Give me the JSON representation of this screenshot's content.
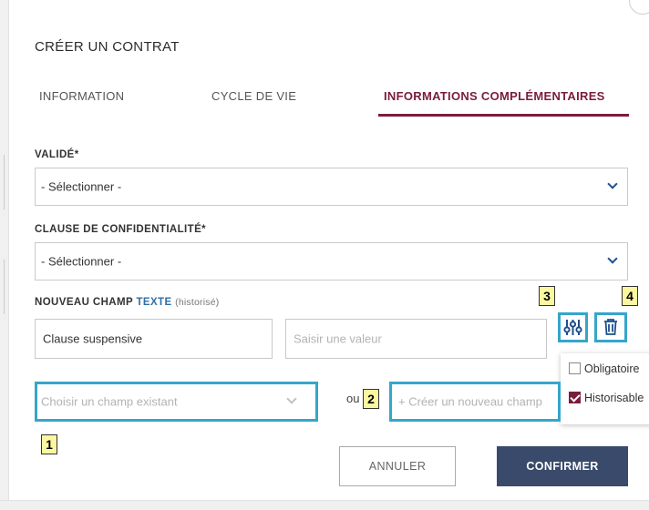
{
  "dialog": {
    "title": "CRÉER UN CONTRAT"
  },
  "tabs": [
    {
      "label": "INFORMATION"
    },
    {
      "label": "CYCLE DE VIE"
    },
    {
      "label": "INFORMATIONS COMPLÉMENTAIRES",
      "active": true
    }
  ],
  "fields": {
    "valide": {
      "label": "VALIDÉ*",
      "value": "- Sélectionner -"
    },
    "clause": {
      "label": "CLAUSE DE CONFIDENTIALITÉ*",
      "value": "- Sélectionner -"
    }
  },
  "new_field": {
    "label_prefix": "NOUVEAU CHAMP",
    "label_type": "TEXTE",
    "label_note": "(historisé)",
    "name_value": "Clause suspensive",
    "value_placeholder": "Saisir une valeur"
  },
  "field_picker": {
    "existing_placeholder": "Choisir un champ existant",
    "or_label": "ou",
    "create_placeholder": "+ Créer un nouveau champ"
  },
  "options_menu": {
    "items": [
      {
        "label": "Obligatoire",
        "checked": false
      },
      {
        "label": "Historisable",
        "checked": true
      }
    ]
  },
  "callouts": [
    "1",
    "2",
    "3",
    "4"
  ],
  "icons": {
    "settings": "sliders-icon",
    "delete": "trash-icon",
    "dropdown": "chevron-down-icon"
  },
  "actions": {
    "cancel": "ANNULER",
    "confirm": "CONFIRMER"
  },
  "colors": {
    "accent": "#7a1d3b",
    "primary_button": "#3a4a6b",
    "highlight": "#35a6c9",
    "callout_bg": "#fbf7a0",
    "link_blue": "#2f6fa5"
  }
}
